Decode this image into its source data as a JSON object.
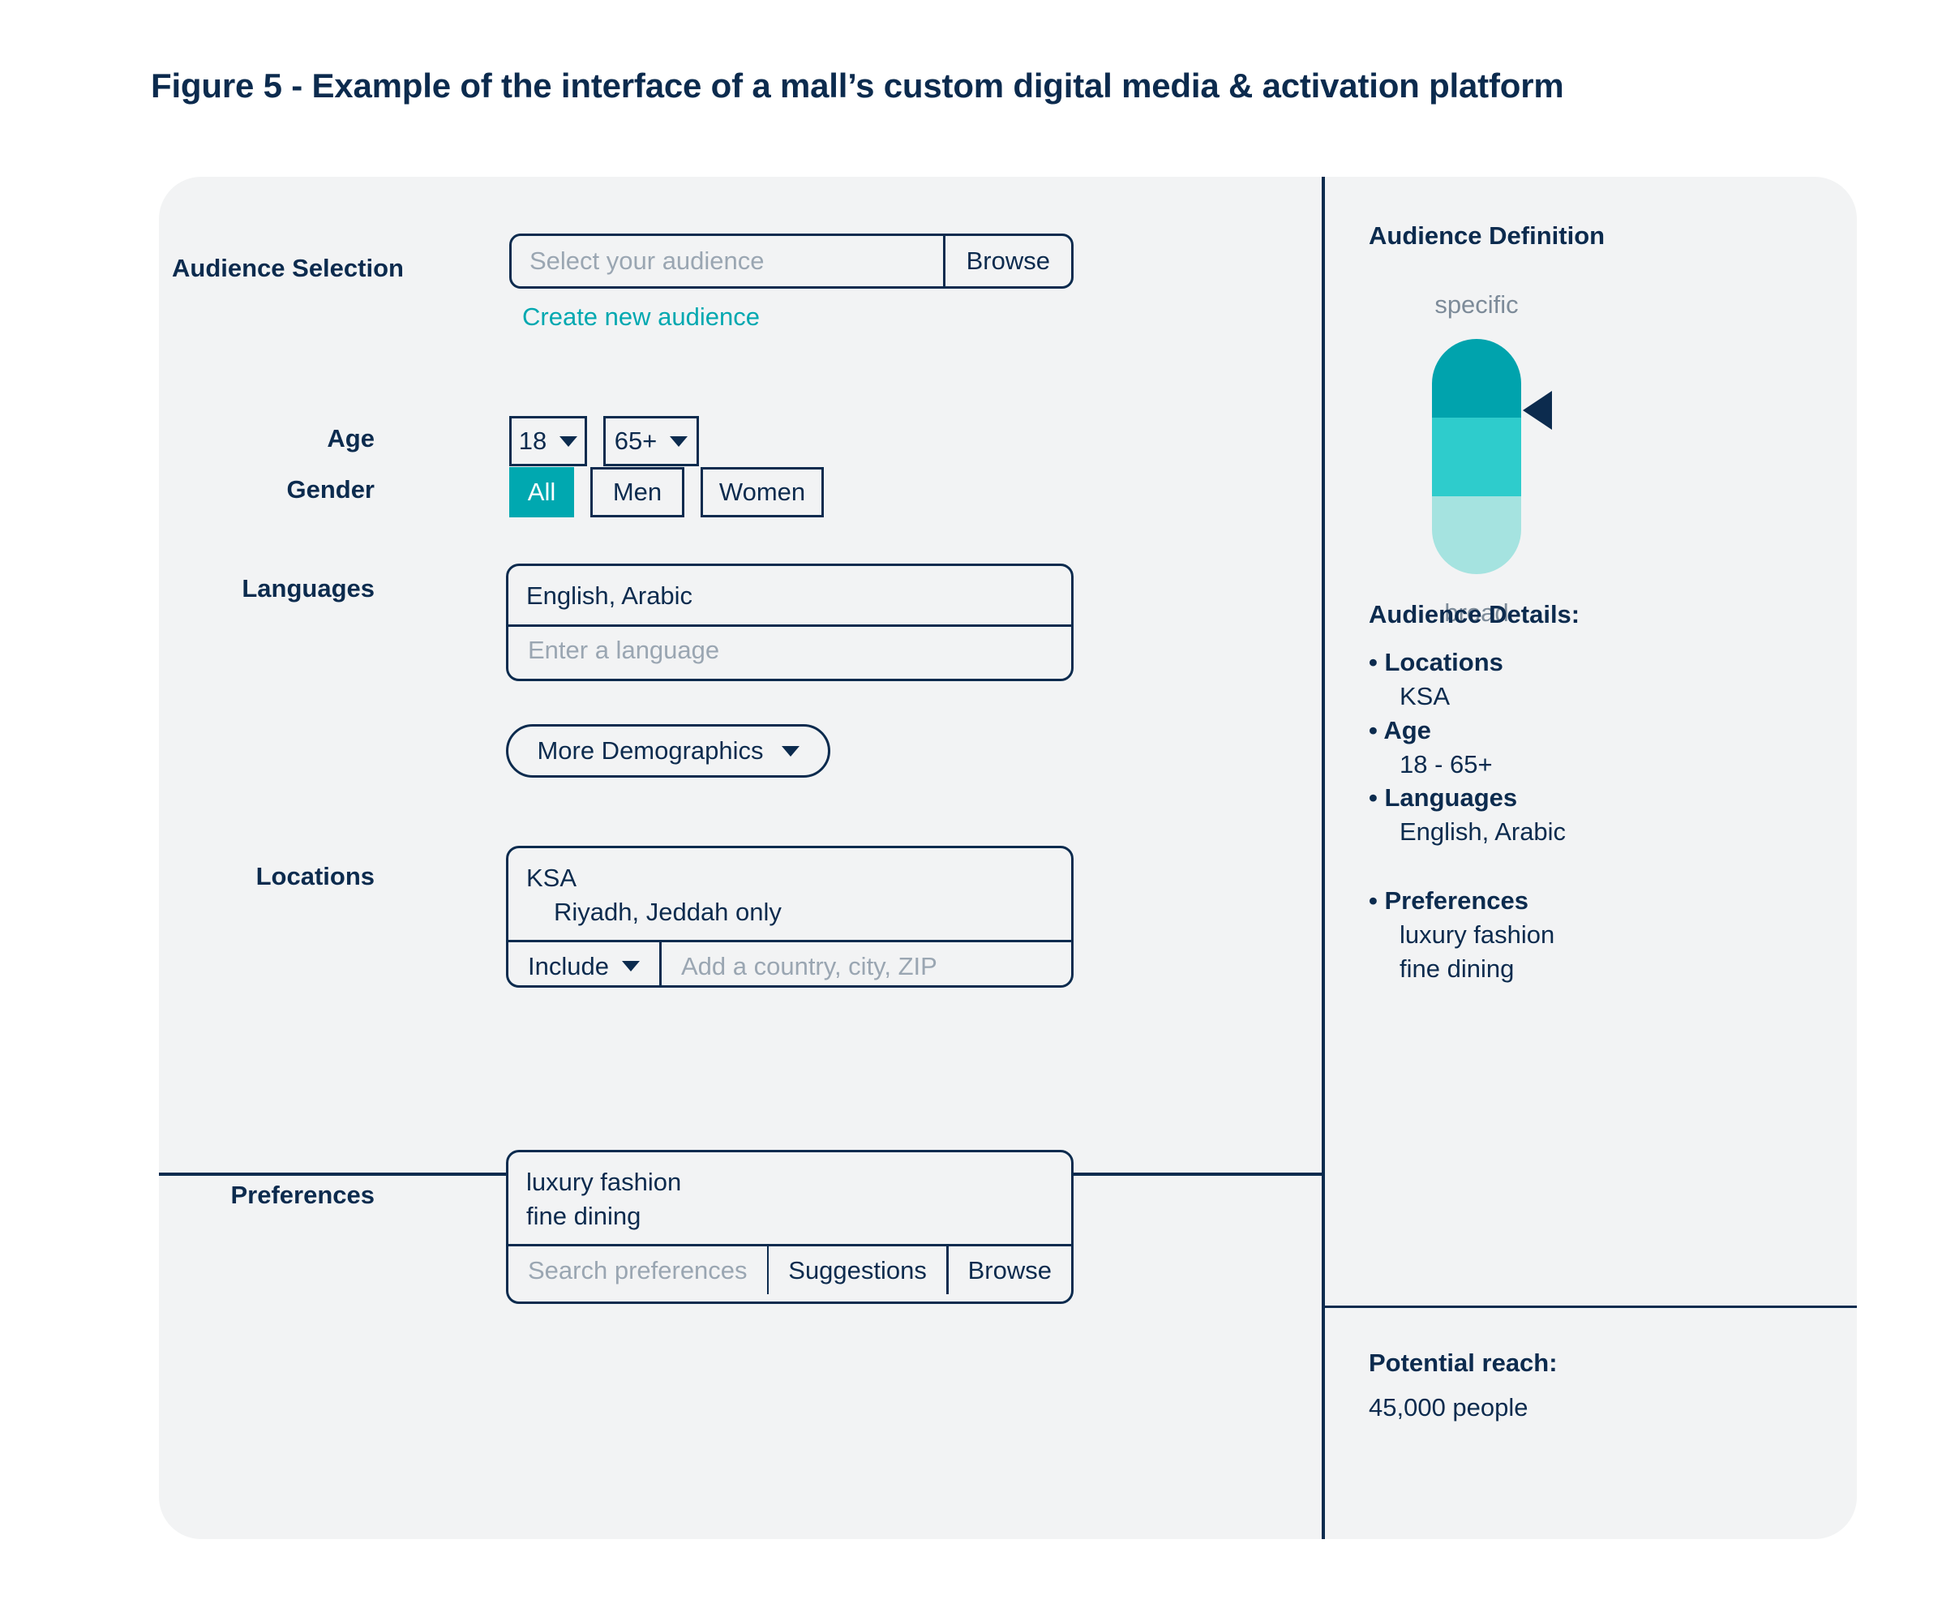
{
  "figure": {
    "title": "Figure 5 - Example of the interface of a mall’s custom digital media & activation platform"
  },
  "colors": {
    "navy": "#0c2b4e",
    "teal_accent": "#00a8b0",
    "teal_dark": "#00a3ad",
    "teal_mid": "#2ecccc",
    "teal_light": "#a5e3e0",
    "panel_bg": "#f2f3f4",
    "muted_text": "#9aa6b2"
  },
  "form": {
    "audience_selection": {
      "label": "Audience Selection",
      "placeholder": "Select your audience",
      "browse_label": "Browse",
      "create_link": "Create new audience"
    },
    "age": {
      "label": "Age",
      "min_value": "18",
      "max_value": "65+"
    },
    "gender": {
      "label": "Gender",
      "options": [
        {
          "label": "All",
          "selected": true
        },
        {
          "label": "Men",
          "selected": false
        },
        {
          "label": "Women",
          "selected": false
        }
      ]
    },
    "languages": {
      "label": "Languages",
      "selected": "English, Arabic",
      "placeholder": "Enter a language"
    },
    "more_demographics": {
      "label": "More Demographics"
    },
    "locations": {
      "label": "Locations",
      "selected_country": "KSA",
      "selected_cities": "Riyadh, Jeddah only",
      "mode_label": "Include",
      "placeholder": "Add a country, city, ZIP"
    },
    "preferences": {
      "label": "Preferences",
      "selected": [
        "luxury fashion",
        "fine dining"
      ],
      "placeholder": "Search preferences",
      "suggestions_label": "Suggestions",
      "browse_label": "Browse"
    }
  },
  "summary": {
    "definition_title": "Audience Definition",
    "meter": {
      "top_caption": "specific",
      "bottom_caption": "broad",
      "pointer_position": "specific"
    },
    "details_title": "Audience Details:",
    "details": [
      {
        "bullet": "• Locations",
        "values": [
          "KSA"
        ]
      },
      {
        "bullet": "• Age",
        "values": [
          "18 - 65+"
        ]
      },
      {
        "bullet": "• Languages",
        "values": [
          "English, Arabic"
        ]
      },
      {
        "bullet": "• Preferences",
        "values": [
          "luxury fashion",
          "fine dining"
        ]
      }
    ],
    "reach_title": "Potential reach:",
    "reach_value": "45,000 people"
  }
}
